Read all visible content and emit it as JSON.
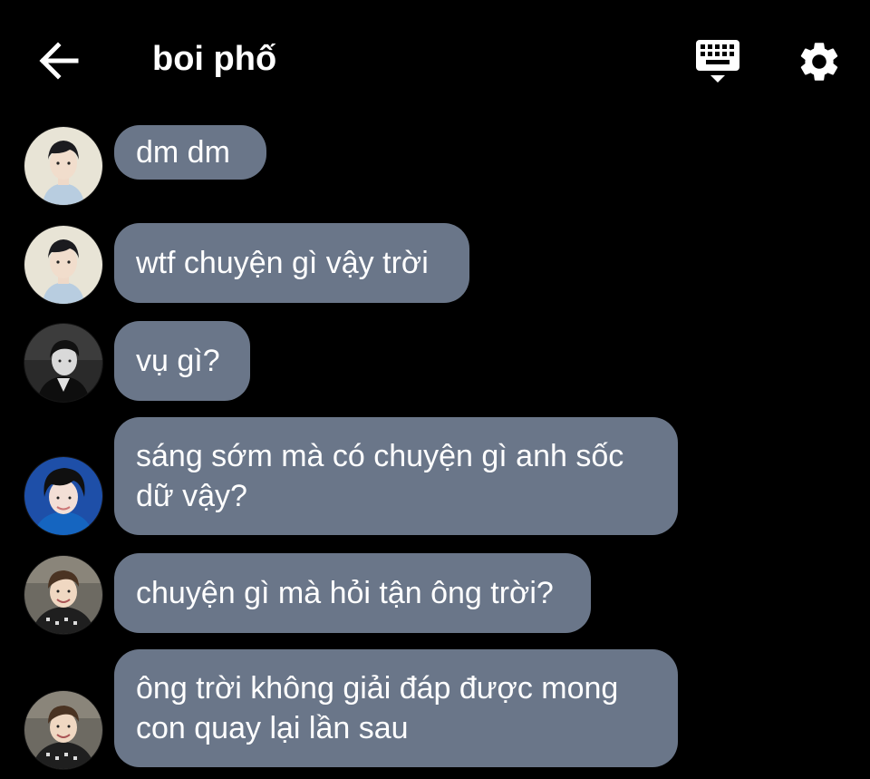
{
  "header": {
    "title": "boi phố",
    "back_icon": "arrow-left-icon",
    "keyboard_icon": "keyboard-icon",
    "settings_icon": "gear-icon"
  },
  "colors": {
    "background": "#000000",
    "bubble": "#6a7689",
    "text": "#ffffff"
  },
  "messages": [
    {
      "text": "dm dm"
    },
    {
      "text": "wtf chuyện gì vậy trời"
    },
    {
      "text": "vụ gì?"
    },
    {
      "text": "sáng sớm mà có chuyện gì anh sốc\ndữ vậy?"
    },
    {
      "text": "chuyện gì mà hỏi tận ông trời?"
    },
    {
      "text": "ông trời không giải đáp được mong\ncon quay lại lần sau"
    }
  ]
}
